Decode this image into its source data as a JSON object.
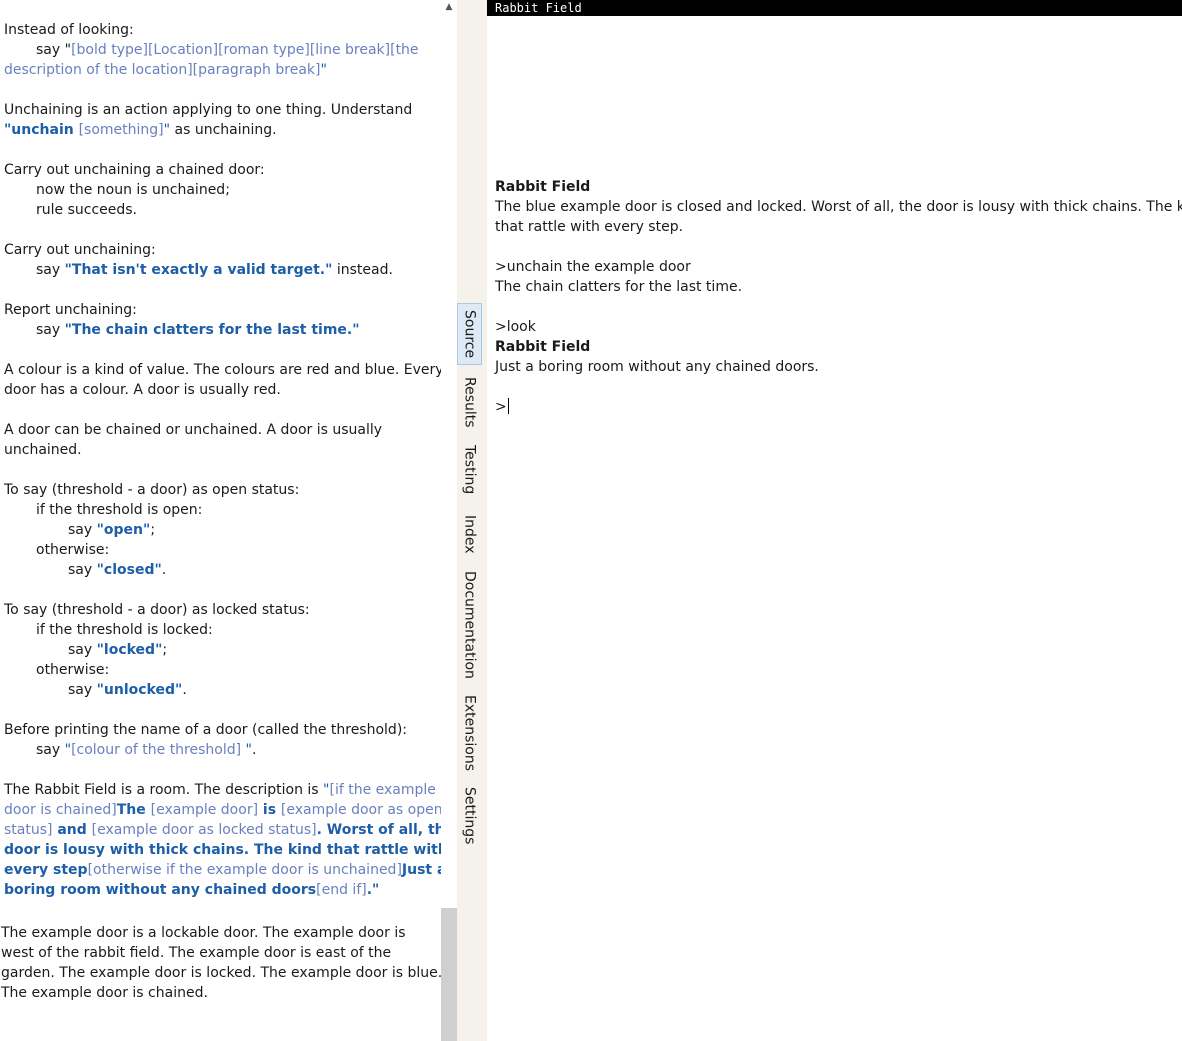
{
  "source": {
    "p1": {
      "l1": "Instead of looking:",
      "l2a": "say \"",
      "l2b": "[bold type][Location][roman type][line break][the",
      "l3a": "description of the location][paragraph break]",
      "l3b": "\""
    },
    "p2": {
      "l1": "Unchaining is an action applying to one thing. Understand",
      "l2a": "\"unchain ",
      "l2b": "[something]",
      "l2c": "\"",
      "l2d": " as unchaining."
    },
    "p3": {
      "l1": "Carry out unchaining a chained door:",
      "l2": "now the noun is unchained;",
      "l3": "rule succeeds."
    },
    "p4": {
      "l1": "Carry out unchaining:",
      "l2a": "say ",
      "l2b": "\"That isn't exactly a valid target.\"",
      "l2c": " instead."
    },
    "p5": {
      "l1": "Report unchaining:",
      "l2a": "say ",
      "l2b": "\"The chain clatters for the last time.\""
    },
    "p6": {
      "l1": "A colour is a kind of value. The colours are red and blue. Every",
      "l2": "door has a colour. A door is usually red."
    },
    "p7": {
      "l1": "A door can be chained or unchained. A door is usually",
      "l2": "unchained."
    },
    "p8": {
      "l1": "To say (threshold - a door) as open status:",
      "l2": "if the threshold is open:",
      "l3a": "say ",
      "l3b": "\"open\"",
      "l3c": ";",
      "l4": "otherwise:",
      "l5a": "say ",
      "l5b": "\"closed\"",
      "l5c": "."
    },
    "p9": {
      "l1": "To say (threshold - a door) as locked status:",
      "l2": "if the threshold is locked:",
      "l3a": "say ",
      "l3b": "\"locked\"",
      "l3c": ";",
      "l4": "otherwise:",
      "l5a": "say ",
      "l5b": "\"unlocked\"",
      "l5c": "."
    },
    "p10": {
      "l1": "Before printing the name of a door (called the threshold):",
      "l2a": "say ",
      "l2b": "\"",
      "l2c": "[colour of the threshold]",
      "l2d": " \"",
      "l2e": "."
    },
    "p11": {
      "l1a": "The Rabbit Field is a room. The description is ",
      "l1b": "\"",
      "l1c": "[if the example",
      "l2a": "door is chained]",
      "l2b": "The ",
      "l2c": "[example door]",
      "l2d": " is ",
      "l2e": "[example door as open",
      "l3a": "status]",
      "l3b": " and ",
      "l3c": "[example door as locked status]",
      "l3d": ". Worst of all, the",
      "l4": "door is lousy with thick chains. The kind that rattle with",
      "l5a": "every step",
      "l5b": "[otherwise if the example door is unchained]",
      "l5c": "Just a",
      "l6a": "boring room without any chained doors",
      "l6b": "[end if]",
      "l6c": ".\""
    },
    "p12": {
      "l1": "The example door is a lockable door. The example door is",
      "l2": "west of the rabbit field. The example door is east of the",
      "l3": "garden. The example door is locked. The example door is blue.",
      "l4": "The example door is chained."
    }
  },
  "tabs": [
    "Source",
    "Results",
    "Testing",
    "Index",
    "Documentation",
    "Extensions",
    "Settings"
  ],
  "active_tab": "Source",
  "game": {
    "status_title": "Rabbit Field",
    "room1": "Rabbit Field",
    "desc1": "The blue example door is closed and locked. Worst of all, the door is lousy with thick chains. The kind",
    "desc2": "that rattle with every step.",
    "cmd1": ">unchain the example door",
    "resp1": "The chain clatters for the last time.",
    "cmd2": ">look",
    "room2": "Rabbit Field",
    "desc3": "Just a boring room without any chained doors.",
    "prompt": ">"
  },
  "colors": {
    "quoted_text": "#1d5ea8",
    "substitution": "#6a7fc0",
    "tab_strip": "#f4f2ea",
    "active_tab": "#dde9f5"
  }
}
